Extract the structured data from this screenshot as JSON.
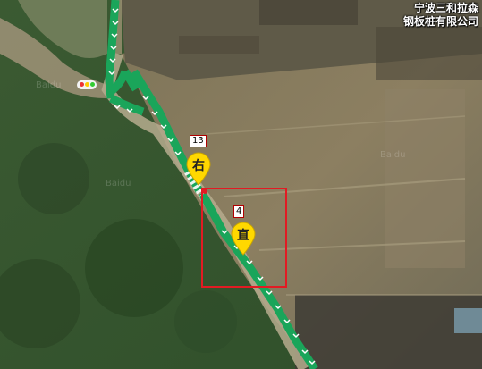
{
  "map": {
    "poi_label_line1": "宁波三和拉森",
    "poi_label_line2": "钢板桩有限公司",
    "watermarks": [
      "Baidu",
      "Baidu",
      "Baidu"
    ],
    "route_color": "#1aa55a",
    "highlight_color": "#e21b23",
    "pin_color": "#ffd800"
  },
  "maneuvers": [
    {
      "step": "13",
      "action": "右"
    },
    {
      "step": "4",
      "action": "直"
    }
  ]
}
